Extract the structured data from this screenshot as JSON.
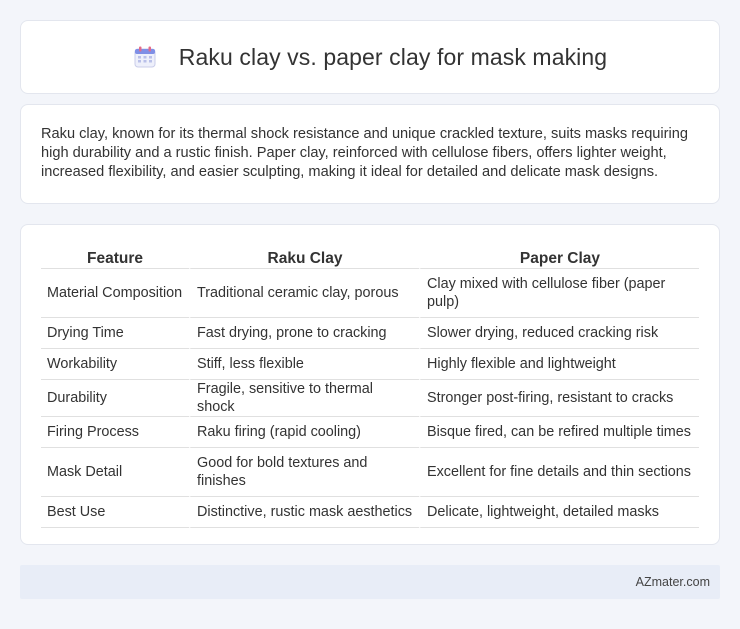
{
  "header": {
    "icon": "calendar-icon",
    "title": "Raku clay vs. paper clay for mask making"
  },
  "description": "Raku clay, known for its thermal shock resistance and unique crackled texture, suits masks requiring high durability and a rustic finish. Paper clay, reinforced with cellulose fibers, offers lighter weight, increased flexibility, and easier sculpting, making it ideal for detailed and delicate mask designs.",
  "table": {
    "columns": [
      "Feature",
      "Raku Clay",
      "Paper Clay"
    ],
    "rows": [
      [
        "Material Composition",
        "Traditional ceramic clay, porous",
        "Clay mixed with cellulose fiber (paper pulp)"
      ],
      [
        "Drying Time",
        "Fast drying, prone to cracking",
        "Slower drying, reduced cracking risk"
      ],
      [
        "Workability",
        "Stiff, less flexible",
        "Highly flexible and lightweight"
      ],
      [
        "Durability",
        "Fragile, sensitive to thermal shock",
        "Stronger post-firing, resistant to cracks"
      ],
      [
        "Firing Process",
        "Raku firing (rapid cooling)",
        "Bisque fired, can be refired multiple times"
      ],
      [
        "Mask Detail",
        "Good for bold textures and finishes",
        "Excellent for fine details and thin sections"
      ],
      [
        "Best Use",
        "Distinctive, rustic mask aesthetics",
        "Delicate, lightweight, detailed masks"
      ]
    ]
  },
  "footer": {
    "brand": "AZmater.com"
  }
}
